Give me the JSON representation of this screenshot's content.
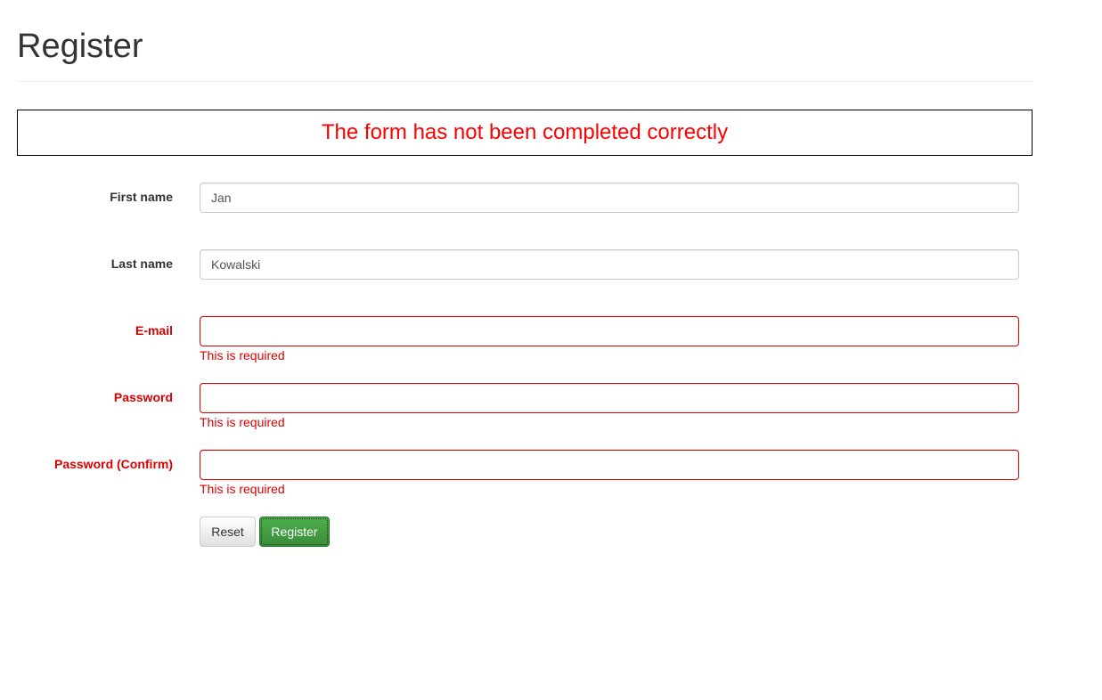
{
  "page": {
    "title": "Register"
  },
  "alert": {
    "message": "The form has not been completed correctly",
    "color": "#ff0000"
  },
  "form": {
    "fields": [
      {
        "label": "First name",
        "value": "Jan",
        "error": ""
      },
      {
        "label": "Last name",
        "value": "Kowalski",
        "error": ""
      },
      {
        "label": "E-mail",
        "value": "",
        "error": "This is required"
      },
      {
        "label": "Password",
        "value": "",
        "error": "This is required"
      },
      {
        "label": "Password (Confirm)",
        "value": "",
        "error": "This is required"
      }
    ],
    "error_color": "#dd0000"
  },
  "actions": {
    "reset_label": "Reset",
    "register_label": "Register",
    "register_color": "#449d44"
  }
}
